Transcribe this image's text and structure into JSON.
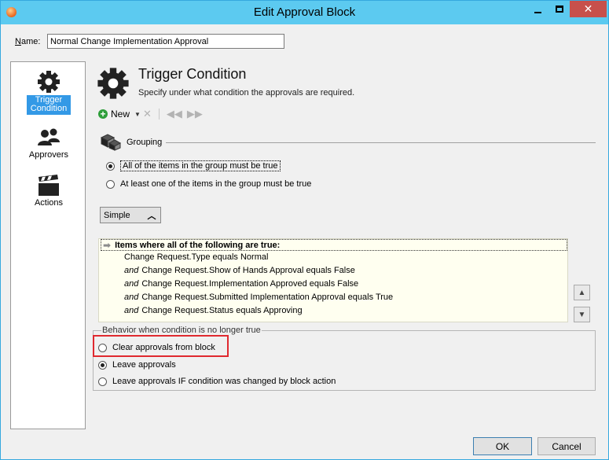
{
  "window": {
    "title": "Edit Approval Block",
    "close_glyph": "✕"
  },
  "name_field": {
    "label_accesskey": "N",
    "label_rest": "ame:",
    "value": "Normal Change Implementation Approval"
  },
  "nav": [
    {
      "label_line1": "Trigger",
      "label_line2": "Condition",
      "icon": "gear-icon",
      "selected": true
    },
    {
      "label": "Approvers",
      "icon": "people-icon"
    },
    {
      "label": "Actions",
      "icon": "clapperboard-icon"
    }
  ],
  "section": {
    "title": "Trigger Condition",
    "description": "Specify under what condition the approvals are required."
  },
  "toolbar": {
    "new_label": "New"
  },
  "grouping": {
    "label": "Grouping",
    "options": [
      {
        "label": "All of the items in the group must be true",
        "checked": true
      },
      {
        "label": "At least one of the items in the group must be true",
        "checked": false
      }
    ]
  },
  "mode_button": {
    "label": "Simple"
  },
  "conditions": {
    "header": "Items where all of the following are true:",
    "lines": [
      {
        "op": "",
        "text": "Change Request.Type equals Normal"
      },
      {
        "op": "and",
        "text": "Change Request.Show of Hands Approval equals False"
      },
      {
        "op": "and",
        "text": "Change Request.Implementation Approved equals False"
      },
      {
        "op": "and",
        "text": "Change Request.Submitted Implementation Approval equals True"
      },
      {
        "op": "and",
        "text": "Change Request.Status equals Approving"
      }
    ]
  },
  "behavior": {
    "legend": "Behavior when condition is no longer true",
    "options": [
      {
        "label": "Clear approvals from block",
        "checked": false
      },
      {
        "label": "Leave approvals",
        "checked": true
      },
      {
        "label": "Leave approvals IF condition was changed by block action",
        "checked": false
      }
    ]
  },
  "buttons": {
    "ok": "OK",
    "cancel": "Cancel"
  },
  "colors": {
    "titlebar": "#5ccaf0",
    "selection": "#3399e6",
    "highlight": "#e0292f",
    "condition_bg": "#fffff0"
  }
}
